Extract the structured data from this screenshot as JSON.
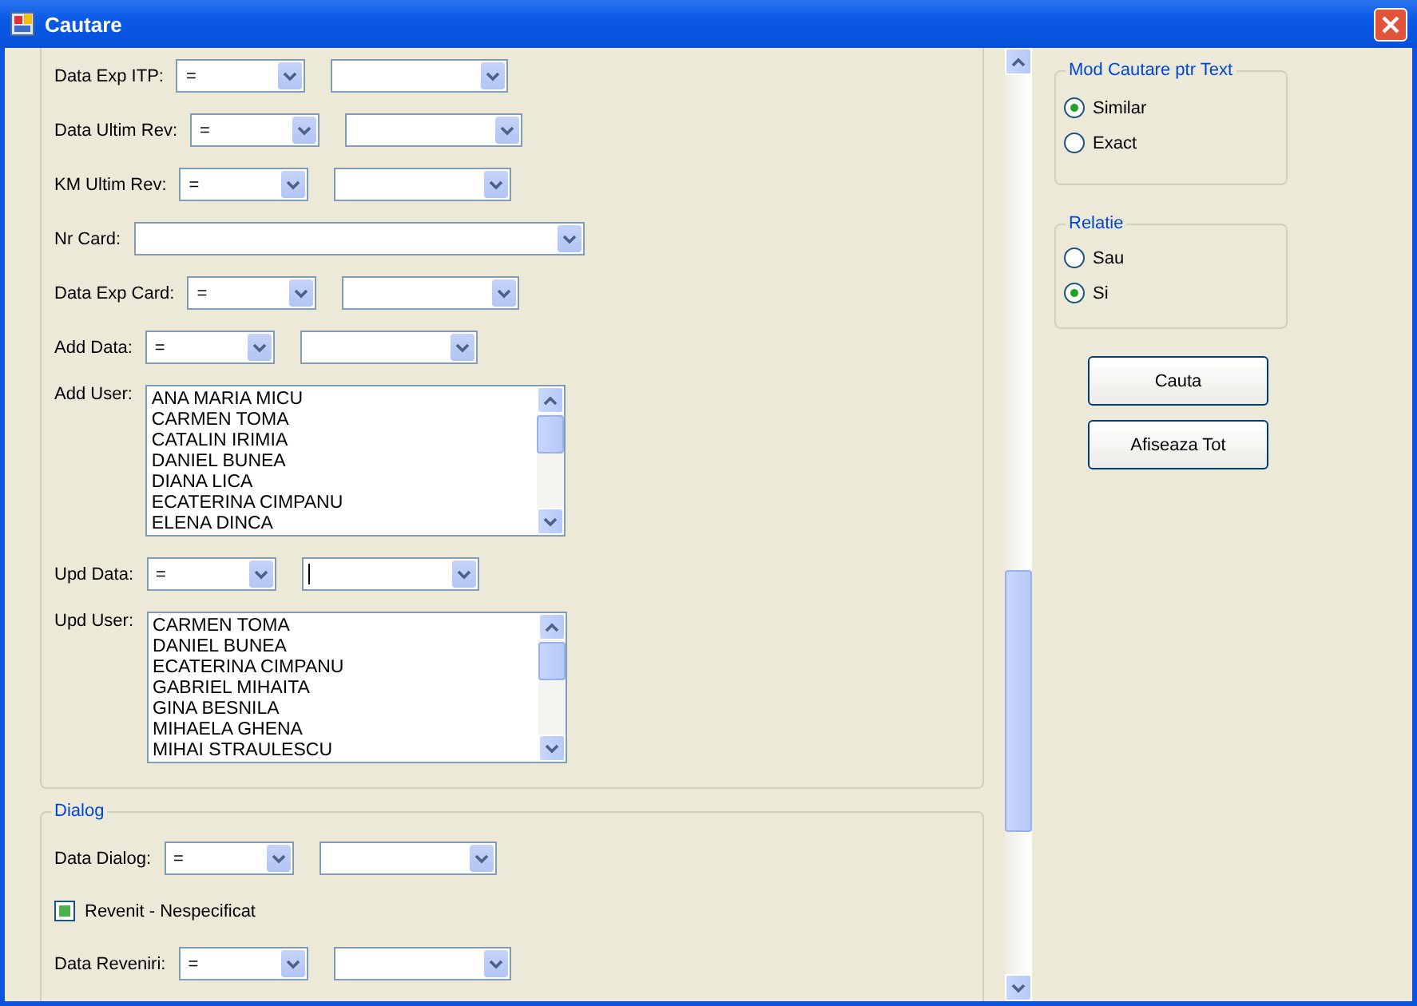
{
  "window": {
    "title": "Cautare"
  },
  "filters": [
    {
      "kind": "compare",
      "label": "Data Exp ITP:",
      "operator": "=",
      "focused": false
    },
    {
      "kind": "compare",
      "label": "Data Ultim Rev:",
      "operator": "=",
      "focused": false
    },
    {
      "kind": "compare",
      "label": "KM Ultim Rev:",
      "operator": "=",
      "focused": false
    },
    {
      "kind": "combo",
      "label": "Nr Card:"
    },
    {
      "kind": "compare",
      "label": "Data Exp Card:",
      "operator": "=",
      "focused": false
    },
    {
      "kind": "compare",
      "label": "Add Data:",
      "operator": "=",
      "focused": false
    },
    {
      "kind": "list",
      "label": "Add User:",
      "items": [
        "ANA MARIA MICU",
        "CARMEN TOMA",
        "CATALIN IRIMIA",
        "DANIEL BUNEA",
        "DIANA LICA",
        "ECATERINA CIMPANU",
        "ELENA DINCA"
      ]
    },
    {
      "kind": "compare",
      "label": "Upd Data:",
      "operator": "=",
      "focused": true
    },
    {
      "kind": "list",
      "label": "Upd User:",
      "items": [
        "CARMEN TOMA",
        "DANIEL BUNEA",
        "ECATERINA CIMPANU",
        "GABRIEL MIHAITA",
        "GINA BESNILA",
        "MIHAELA GHENA",
        "MIHAI STRAULESCU"
      ]
    }
  ],
  "dialog": {
    "title": "Dialog",
    "rows": [
      {
        "kind": "compare",
        "label": "Data Dialog:",
        "operator": "=",
        "focused": false
      },
      {
        "kind": "checkbox",
        "label": "Revenit - Nespecificat",
        "checked": true
      },
      {
        "kind": "compare",
        "label": "Data Reveniri:",
        "operator": "=",
        "focused": false
      }
    ]
  },
  "text_search_mode": {
    "title": "Mod Cautare ptr Text",
    "options": [
      {
        "label": "Similar",
        "selected": true
      },
      {
        "label": "Exact",
        "selected": false
      }
    ]
  },
  "relation": {
    "title": "Relatie",
    "options": [
      {
        "label": "Sau",
        "selected": false
      },
      {
        "label": "Si",
        "selected": true
      }
    ]
  },
  "buttons": [
    "Cauta",
    "Afiseaza Tot"
  ]
}
